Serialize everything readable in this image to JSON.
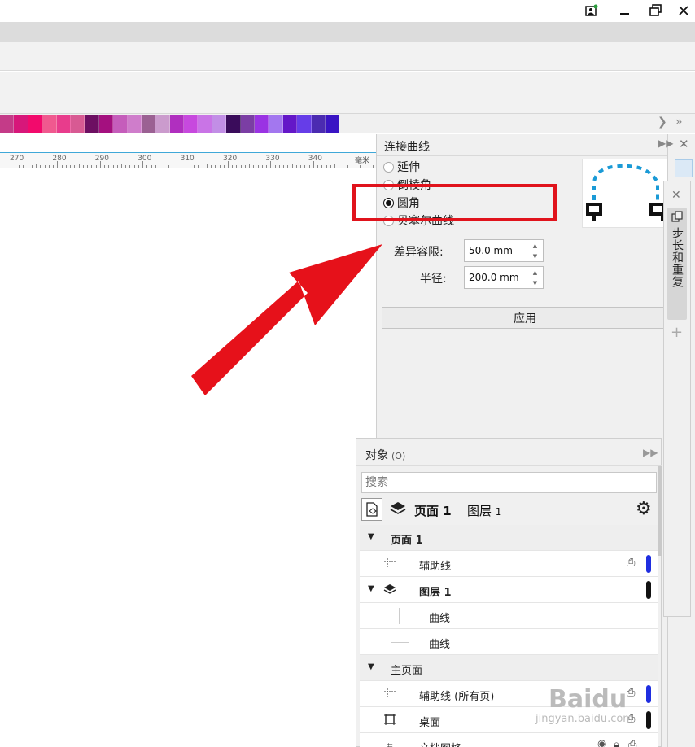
{
  "palette": {
    "colors": [
      "#c43b88",
      "#d7177a",
      "#f20a6c",
      "#f0598f",
      "#e83c8c",
      "#d85a93",
      "#6d0f62",
      "#a4107f",
      "#c55dbb",
      "#cf7dcb",
      "#9b6193",
      "#cb9bcd",
      "#b02fbf",
      "#c749de",
      "#c974e6",
      "#c28ee6",
      "#3a0c5b",
      "#7b3ea4",
      "#9a33e3",
      "#a377ef",
      "#6417c8",
      "#663de8",
      "#4b2bb1",
      "#3a14c4"
    ]
  },
  "ruler": {
    "labels": [
      "270",
      "280",
      "290",
      "300",
      "310",
      "320",
      "330",
      "340"
    ],
    "unit": "毫米"
  },
  "connect_docker": {
    "title": "连接曲线",
    "options": [
      {
        "label": "延伸",
        "checked": false
      },
      {
        "label": "倒棱角",
        "checked": false
      },
      {
        "label": "圆角",
        "checked": true
      },
      {
        "label": "贝塞尔曲线",
        "checked": false
      }
    ],
    "tolerance_label": "差异容限:",
    "tolerance_value": "50.0 mm",
    "radius_label": "半径:",
    "radius_value": "200.0 mm",
    "apply_label": "应用"
  },
  "side_tab": {
    "label": "步长和重复"
  },
  "objects_docker": {
    "title": "对象",
    "hotkey": "(O)",
    "search_placeholder": "搜索",
    "page_label": "页面 1",
    "layer_label": "图层",
    "layer_number": "1",
    "tree": [
      {
        "label": "页面 1",
        "level": 0
      },
      {
        "label": "辅助线",
        "level": 1
      },
      {
        "label": "图层 1",
        "level": 1
      },
      {
        "label": "曲线",
        "level": 2
      },
      {
        "label": "曲线",
        "level": 2
      },
      {
        "label": "主页面",
        "level": 0
      },
      {
        "label": "辅助线 (所有页)",
        "level": 1
      },
      {
        "label": "桌面",
        "level": 1
      },
      {
        "label": "文档网格",
        "level": 1
      }
    ]
  },
  "annotation": {
    "highlight_color": "#e0131c"
  },
  "watermark": {
    "text": "Baidu",
    "sub": "jingyan.baidu.com"
  },
  "icons": [
    "restore-icon",
    "minimize-icon",
    "maximize-icon",
    "close-icon",
    "expand-icon",
    "gear-icon",
    "eye-icon",
    "printer-icon",
    "plus-icon"
  ]
}
